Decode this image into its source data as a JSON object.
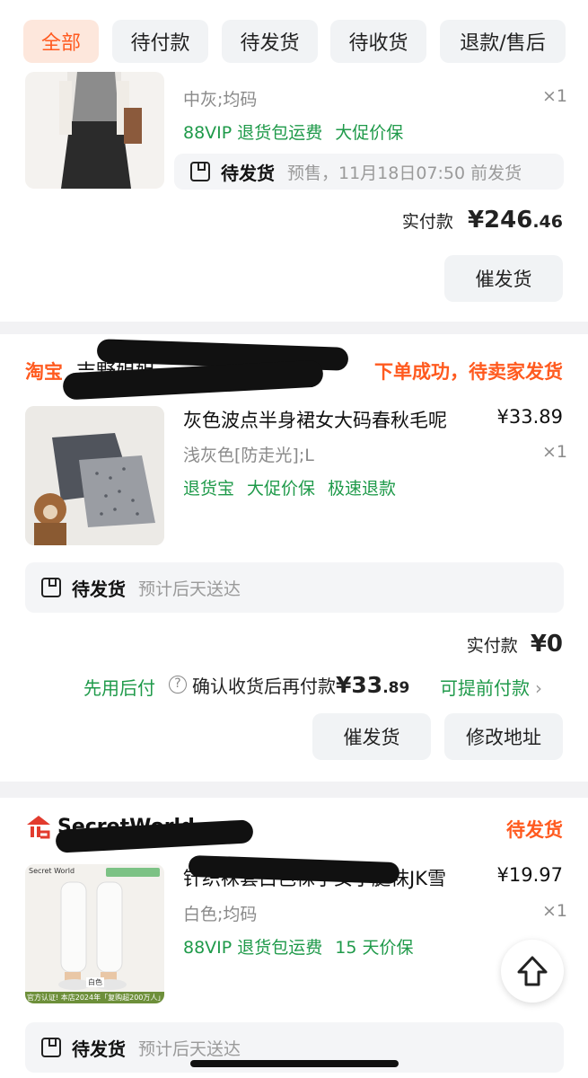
{
  "tabs": [
    {
      "label": "全部",
      "active": true
    },
    {
      "label": "待付款",
      "active": false
    },
    {
      "label": "待发货",
      "active": false
    },
    {
      "label": "待收货",
      "active": false
    },
    {
      "label": "退款/售后",
      "active": false
    }
  ],
  "order1": {
    "spec": "中灰;均码",
    "qty": "×1",
    "tags": [
      "88VIP 退货包运费",
      "大促价保"
    ],
    "status": "待发货",
    "status_sub": "预售，11月18日07:50 前发货",
    "paid_label": "实付款",
    "paid_big": "¥246",
    "paid_small": ".46",
    "button": "催发货"
  },
  "order2": {
    "shop_prefix": "淘宝",
    "shop_name": "吉野姐姐",
    "order_status": "下单成功，待卖家发货",
    "title": "灰色波点半身裙女大码春秋毛呢",
    "price": "¥33.89",
    "spec": "浅灰色[防走光];L",
    "qty": "×1",
    "tags": [
      "退货宝",
      "大促价保",
      "极速退款"
    ],
    "status": "待发货",
    "status_sub": "预计后天送达",
    "paid_label": "实付款",
    "paid_big": "¥0",
    "later_pay": "先用后付",
    "confirm_text": "确认收货后再付款",
    "confirm_amount_big": "¥33",
    "confirm_amount_small": ".89",
    "early_pay": "可提前付款",
    "button1": "催发货",
    "button2": "修改地址"
  },
  "order3": {
    "shop_name": "SecretWorld",
    "order_status": "待发货",
    "title": "针织袜套白色袜子女小腿袜JK雪",
    "price": "¥19.97",
    "spec": "白色;均码",
    "qty": "×1",
    "tags": [
      "88VIP 退货包运费",
      "15 天价保"
    ],
    "thumb_brand": "Secret World",
    "thumb_color": "白色",
    "thumb_footer": "官方认证! 本店2024年「复购超200万人」",
    "status": "待发货",
    "status_sub": "预计后天送达"
  },
  "colors": {
    "accent": "#ff5a1f",
    "green": "#1f9a4a"
  }
}
